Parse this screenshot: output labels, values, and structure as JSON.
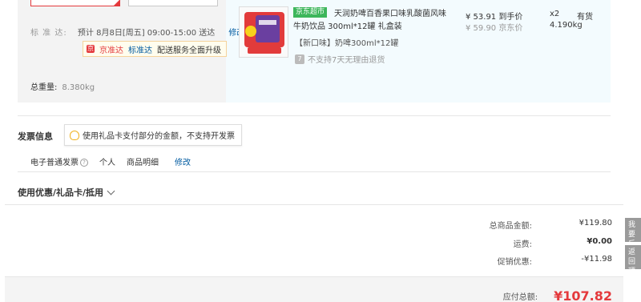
{
  "shipping": {
    "label": "标 准 达:",
    "value": "预计 8月8日[周五] 09:00-15:00 送达",
    "edit_label": "修改",
    "upgrade": {
      "brand": "京准达",
      "brand2": "标准达",
      "text": "配送服务全面升级"
    },
    "weight_label": "总重量:",
    "weight_value": "8.380kg"
  },
  "item": {
    "tag": "京东超市",
    "name_line1": "天润奶啤百香果口味乳酸菌风味",
    "name_line2": "牛奶饮品 300ml*12罐 礼盒装",
    "spec": "【新口味】奶啤300ml*12罐",
    "no_return": "不支持7天无理由退货",
    "price": "¥ 53.91 到手价",
    "orig_price": "¥ 59.90 京东价",
    "qty": "x2",
    "weight": "4.190kg",
    "stock": "有货",
    "colors": {
      "tag_bg": "#3db65b",
      "product_red": "#e23b3b",
      "product_purple": "#6a3fa0"
    }
  },
  "invoice": {
    "title": "发票信息",
    "tip": "使用礼品卡支付部分的金额，不支持开发票",
    "type": "电子普通发票",
    "holder": "个人",
    "content": "商品明细",
    "edit_label": "修改"
  },
  "coupon": {
    "label": "使用优惠/礼品卡/抵用"
  },
  "summary": {
    "goods_label": "总商品金额:",
    "goods_value": "¥119.80",
    "freight_label": "运费:",
    "freight_value": "¥0.00",
    "promo_label": "促销优惠:",
    "promo_value": "-¥11.98",
    "total_label": "应付总额:",
    "total_value": "¥107.82"
  },
  "side": {
    "feedback": "我要反馈",
    "top": "返回顶部"
  },
  "accent": "#e4393c",
  "link": "#005aa0"
}
